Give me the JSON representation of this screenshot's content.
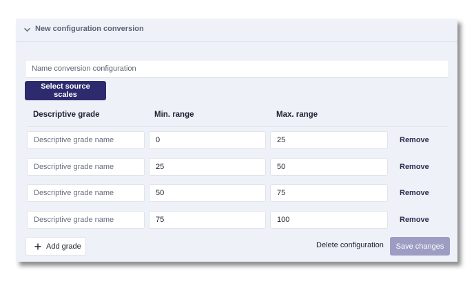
{
  "panel": {
    "title": "New configuration conversion",
    "name_placeholder": "Name conversion configuration",
    "name_value": ""
  },
  "buttons": {
    "select_source_scales": "Select source scales",
    "add_grade": "Add grade",
    "delete_configuration": "Delete configuration",
    "save_changes": "Save changes"
  },
  "table": {
    "columns": [
      "Descriptive grade",
      "Min. range",
      "Max. range"
    ],
    "rows": [
      {
        "name_placeholder": "Descriptive grade name",
        "min": "0",
        "max": "25",
        "action": "Remove"
      },
      {
        "name_placeholder": "Descriptive grade name",
        "min": "25",
        "max": "50",
        "action": "Remove"
      },
      {
        "name_placeholder": "Descriptive grade name",
        "min": "50",
        "max": "75",
        "action": "Remove"
      },
      {
        "name_placeholder": "Descriptive grade name",
        "min": "75",
        "max": "100",
        "action": "Remove"
      }
    ]
  },
  "colors": {
    "panel_bg": "#eef1f7",
    "primary": "#2d2a6e",
    "save_disabled": "#9d9cc3"
  },
  "icons": {
    "collapse": "chevron-down-icon",
    "add": "plus-icon"
  }
}
